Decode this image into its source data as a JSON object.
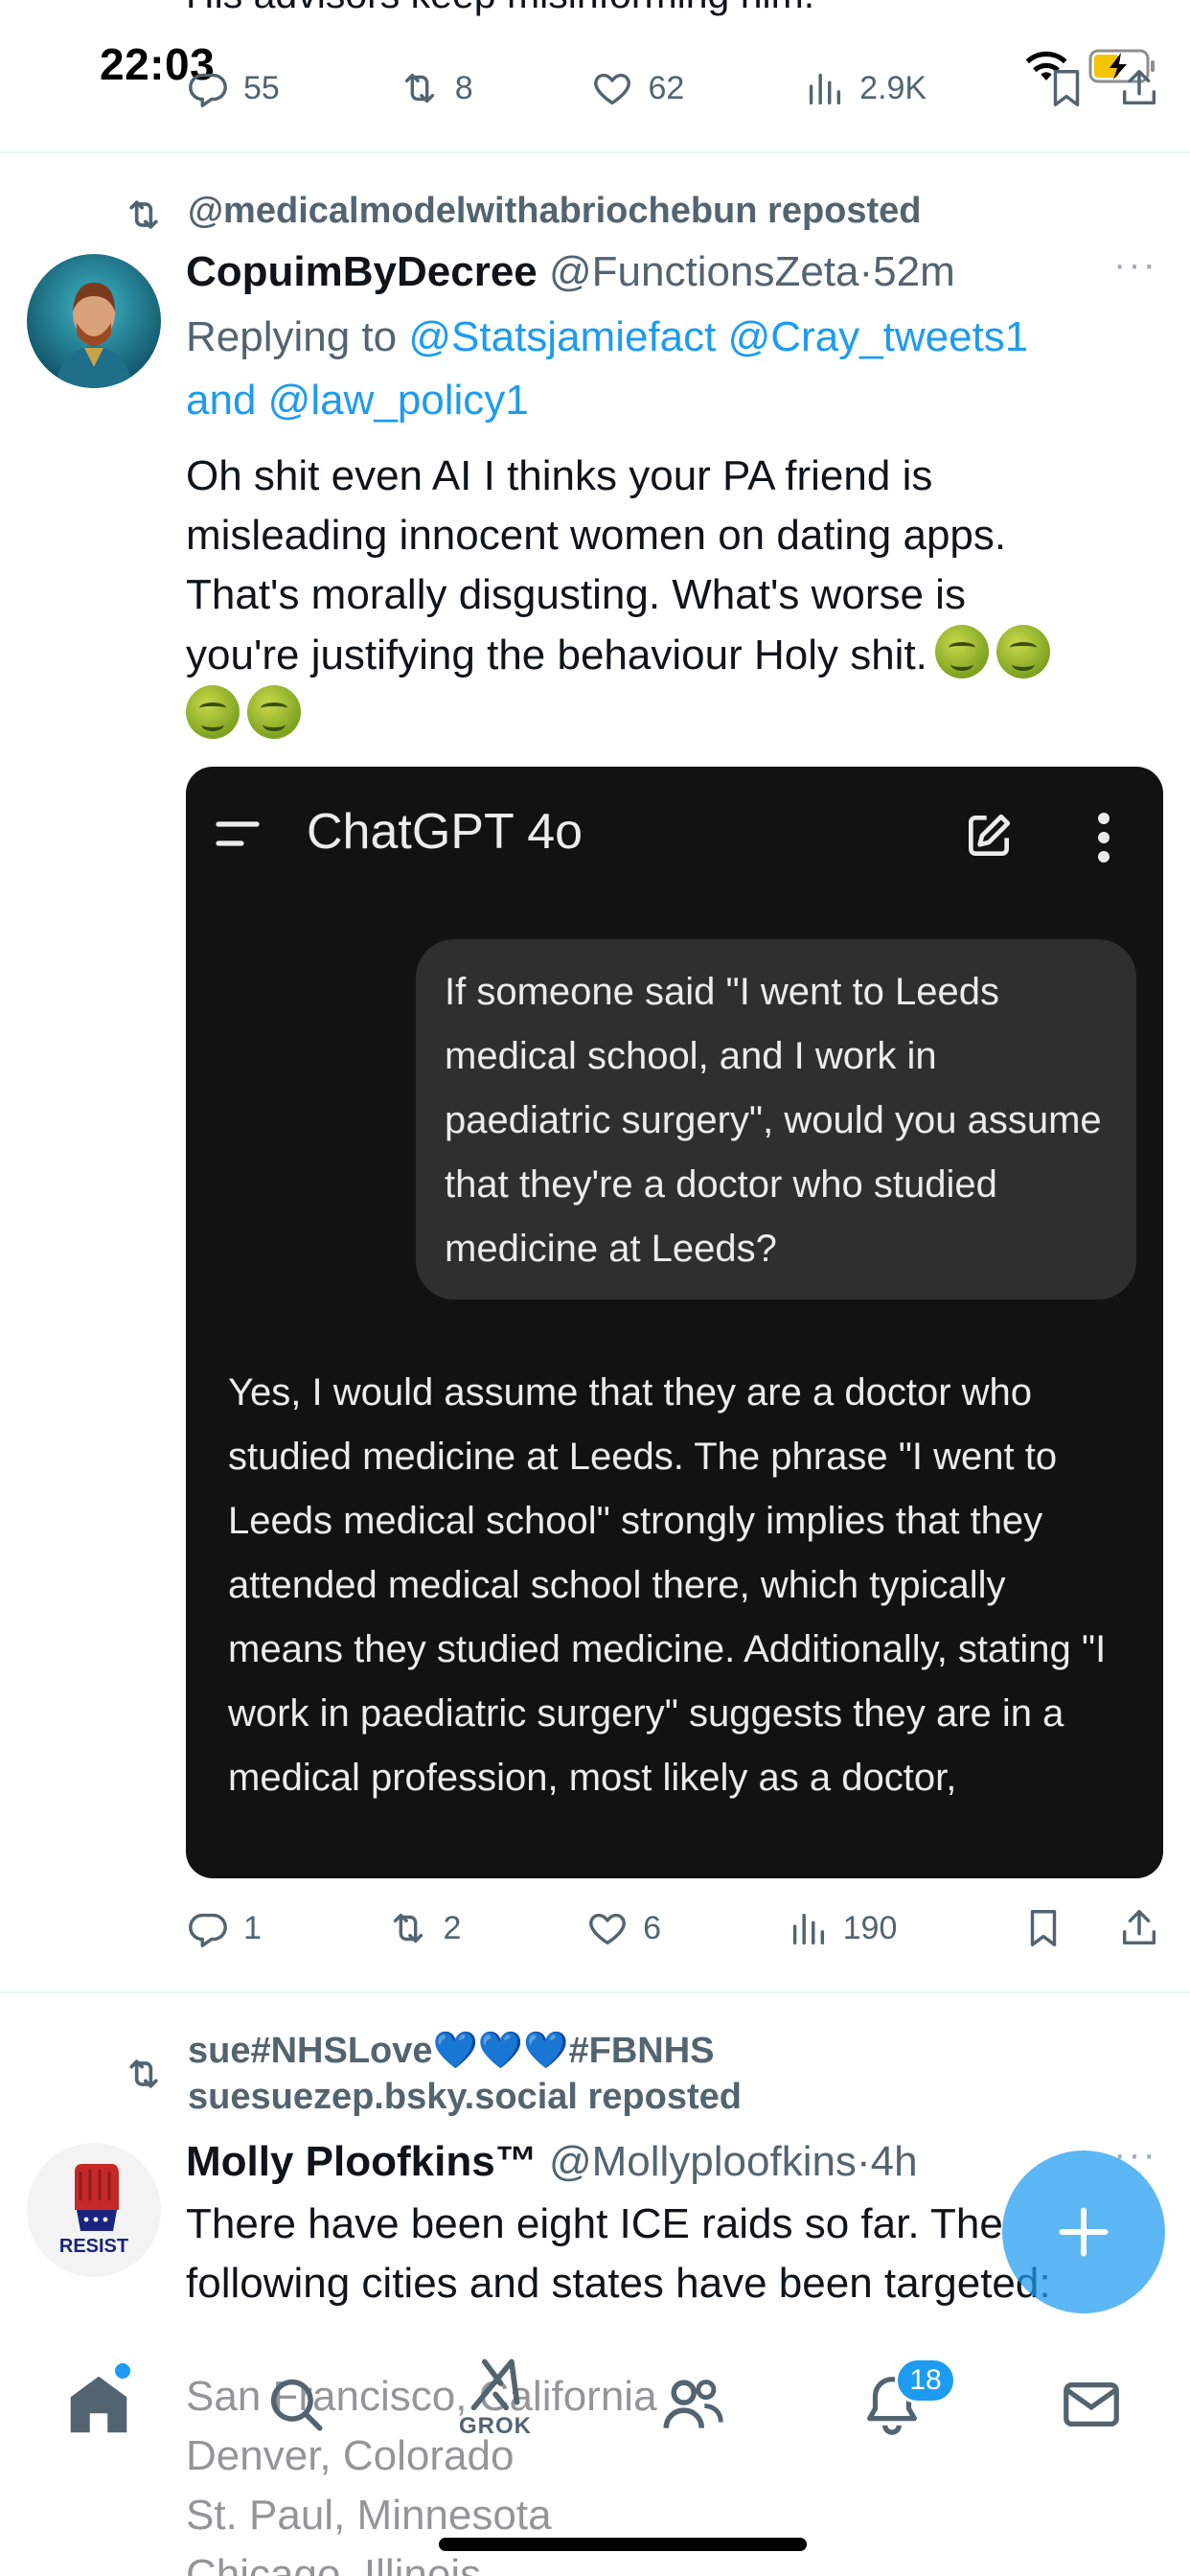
{
  "status_bar": {
    "time": "22:03"
  },
  "top_tweet": {
    "text": "His advisors keep misinforming him.",
    "replies": "55",
    "reposts": "8",
    "likes": "62",
    "views": "2.9K"
  },
  "tweet1": {
    "reposted_by": "@medicalmodelwithabriochebun reposted",
    "display_name": "CopuimByDecree",
    "handle": "@FunctionsZeta",
    "sep": "·",
    "time": "52m",
    "replying_prefix": "Replying to",
    "replying_mentions_1": "@Statsjamiefact @Cray_tweets1",
    "replying_and": "and",
    "replying_mentions_2": "@law_policy1",
    "text_line1": "Oh shit even AI I thinks your PA friend is",
    "text_line2": "misleading innocent women on dating apps.",
    "text_line3": "That's morally disgusting. What's worse is",
    "text_line4": "you're justifying the behaviour Holy shit.",
    "emoji": "nauseated-face",
    "replies": "1",
    "reposts": "2",
    "likes": "6",
    "views": "190"
  },
  "chatgpt_card": {
    "title": "ChatGPT 4o",
    "user_message": "If someone said \"I went to Leeds medical school, and I work in paediatric surgery\", would you assume that they're a doctor who studied medicine at Leeds?",
    "assistant_message": "Yes, I would assume that they are a doctor who studied medicine at Leeds. The phrase \"I went to Leeds medical school\" strongly implies that they attended medical school there, which typically means they studied medicine. Additionally, stating \"I work in paediatric surgery\" suggests they are in a medical profession, most likely as a doctor,"
  },
  "tweet2": {
    "reposted_by_line1": "sue#NHSLove💙💙💙#FBNHS",
    "reposted_by_line2": "suesuezep.bsky.social reposted",
    "display_name": "Molly Ploofkins™",
    "handle": "@Mollyploofkins",
    "sep": "·",
    "time": "4h",
    "text_line1": "There have been eight ICE raids so far. The",
    "text_line2": "following cities and states have been targeted:",
    "text_line3": "San Francisco, California",
    "text_line4": "Denver, Colorado",
    "text_line5": "St. Paul, Minnesota",
    "text_line6": "Chicago, Illinois"
  },
  "tabbar": {
    "grok_label": "GROK",
    "notifications_badge": "18"
  },
  "colors": {
    "accent": "#1d9bf0",
    "muted": "#536471",
    "card_bg": "#121212"
  }
}
